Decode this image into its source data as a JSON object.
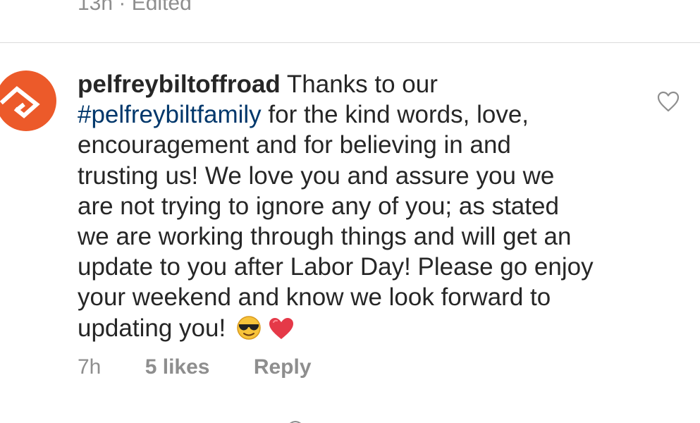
{
  "previous_comment": {
    "meta": "13h · Edited"
  },
  "comment": {
    "username": "pelfreybiltoffroad",
    "line1_text": "Thanks to our",
    "hashtag": "#pelfreybiltfamily",
    "line2_text": "for the kind words, love,",
    "lines": [
      "encouragement and for believing in and",
      "trusting us! We love you and assure you we",
      "are not trying to ignore any of you; as stated",
      "we are working through things and will get an",
      "update to you after Labor Day! Please go enjoy",
      "your weekend and know we look forward to"
    ],
    "last_line_text": "updating you!",
    "emojis": [
      "sunglasses-face",
      "red-heart"
    ],
    "time": "7h",
    "likes": "5 likes",
    "reply": "Reply"
  },
  "colors": {
    "avatar": "#ec5a2a",
    "hashtag": "#00376b",
    "muted": "#8e8e8e",
    "text": "#262626"
  }
}
